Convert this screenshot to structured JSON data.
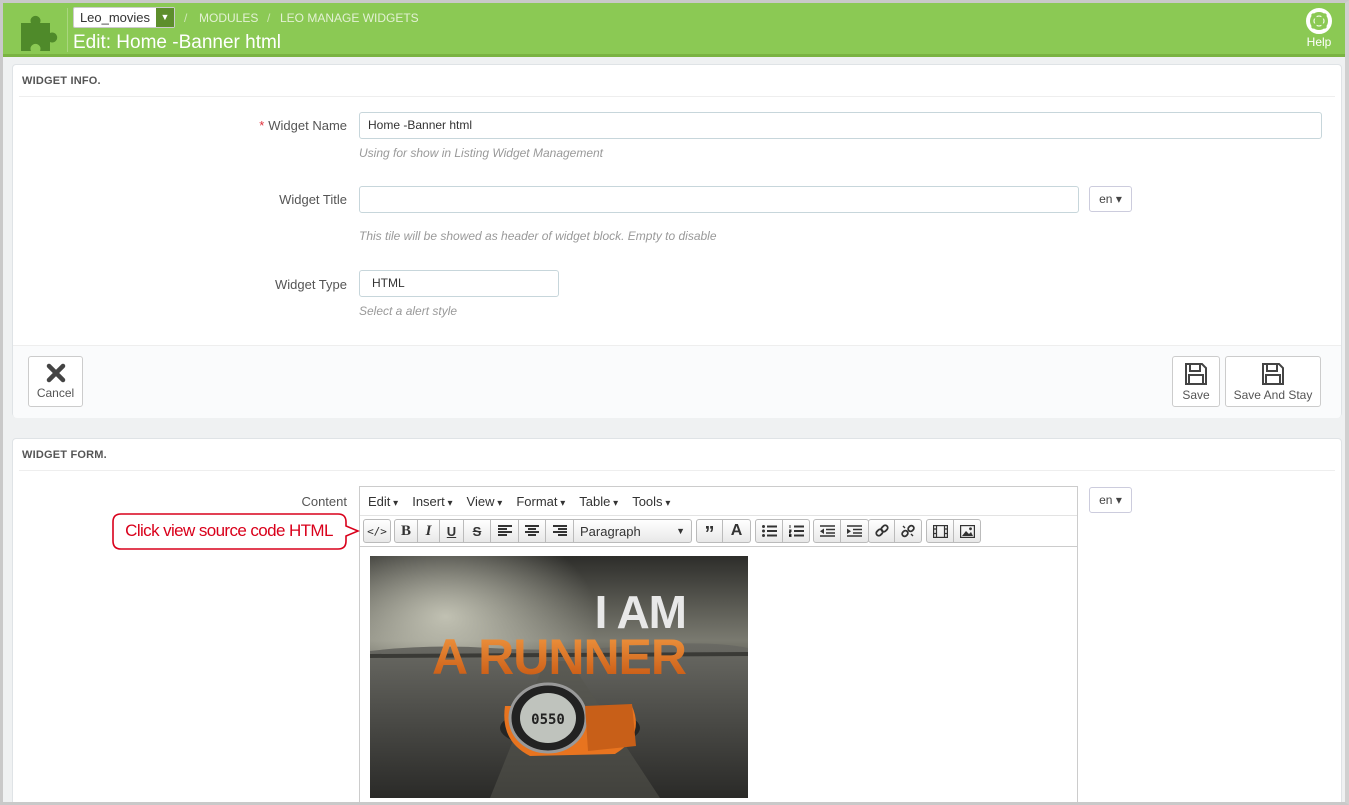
{
  "header": {
    "shop_selector": "Leo_movies",
    "breadcrumb": [
      "MODULES",
      "LEO MANAGE WIDGETS"
    ],
    "title": "Edit: Home -Banner html",
    "help_label": "Help"
  },
  "widget_info": {
    "heading": "WIDGET INFO.",
    "name_label": "Widget Name",
    "name_required_mark": "*",
    "name_value": "Home -Banner html",
    "name_help": "Using for show in Listing Widget Management",
    "title_label": "Widget Title",
    "title_value": "",
    "title_lang": "en",
    "title_help": "This tile will be showed as header of widget block. Empty to disable",
    "type_label": "Widget Type",
    "type_value": "HTML",
    "type_help": "Select a alert style",
    "cancel_label": "Cancel",
    "save_label": "Save",
    "save_stay_label": "Save And Stay"
  },
  "widget_form": {
    "heading": "WIDGET FORM.",
    "content_label": "Content",
    "content_lang": "en",
    "editor_menu": [
      "Edit",
      "Insert",
      "View",
      "Format",
      "Table",
      "Tools"
    ],
    "format_select": "Paragraph",
    "banner_text_line1": "I AM",
    "banner_text_line2": "A RUNNER",
    "watch_display": "0550"
  },
  "annotation": {
    "callout_text": "Click view source code HTML",
    "color": "#d9001b"
  },
  "colors": {
    "header_green": "#8bc954",
    "accent_orange": "#e8741f"
  }
}
